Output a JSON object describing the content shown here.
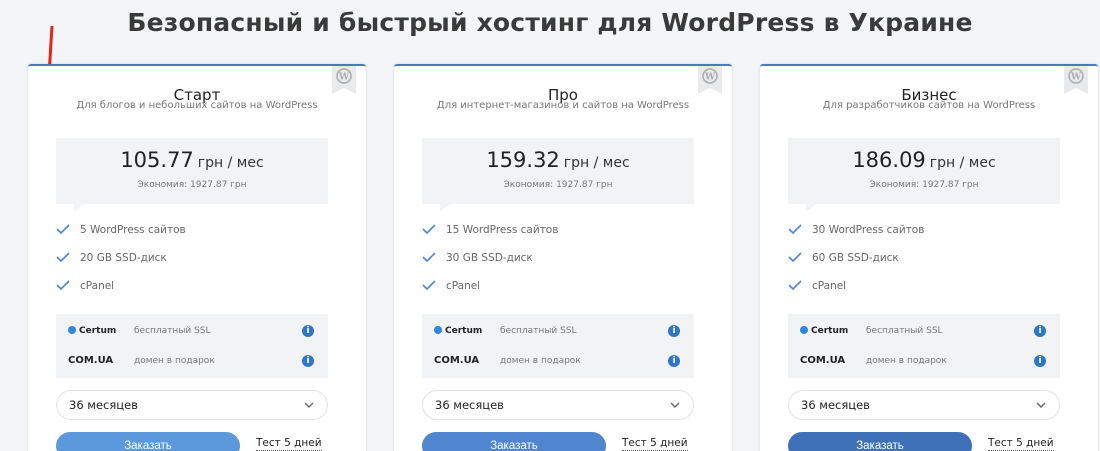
{
  "title": "Безопасный и быстрый хостинг для WordPress в Украине",
  "plans": [
    {
      "name": "Старт",
      "description": "Для блогов и небольших сайтов на WordPress",
      "price": "105.77",
      "price_unit": "грн / мес",
      "saving": "Экономия: 1927.87 грн",
      "features": [
        "5 WordPress сайтов",
        "20 GB SSD-диск",
        "cPanel"
      ],
      "ssl_logo": "Certum",
      "ssl_text": "бесплатный SSL",
      "domain_logo": "COM.UA",
      "domain_text": "домен в подарок",
      "period": "36 месяцев",
      "order_label": "Заказать",
      "order_color": "#5b98dc",
      "trial_label": "Тест 5 дней"
    },
    {
      "name": "Про",
      "description": "Для интернет-магазинов и сайтов на WordPress",
      "price": "159.32",
      "price_unit": "грн / мес",
      "saving": "Экономия: 1927.87 грн",
      "features": [
        "15 WordPress сайтов",
        "30 GB SSD-диск",
        "cPanel"
      ],
      "ssl_logo": "Certum",
      "ssl_text": "бесплатный SSL",
      "domain_logo": "COM.UA",
      "domain_text": "домен в подарок",
      "period": "36 месяцев",
      "order_label": "Заказать",
      "order_color": "#4f86cf",
      "trial_label": "Тест 5 дней"
    },
    {
      "name": "Бизнес",
      "description": "Для разработчиков сайтов на WordPress",
      "price": "186.09",
      "price_unit": "грн / мес",
      "saving": "Экономия: 1927.87 грн",
      "features": [
        "30 WordPress сайтов",
        "60 GB SSD-диск",
        "cPanel"
      ],
      "ssl_logo": "Certum",
      "ssl_text": "бесплатный SSL",
      "domain_logo": "COM.UA",
      "domain_text": "домен в подарок",
      "period": "36 месяцев",
      "order_label": "Заказать",
      "order_color": "#3f71b8",
      "trial_label": "Тест 5 дней"
    }
  ],
  "colors": {
    "accent": "#4a78c4",
    "check": "#4a86d6",
    "info": "#2f76c8",
    "arrow": "#e8211d"
  },
  "icons": {
    "badge": "wordpress-icon",
    "check": "check-icon",
    "info": "info-icon",
    "dropdown": "chevron-down-icon",
    "annotation": "red-arrow-icon"
  }
}
